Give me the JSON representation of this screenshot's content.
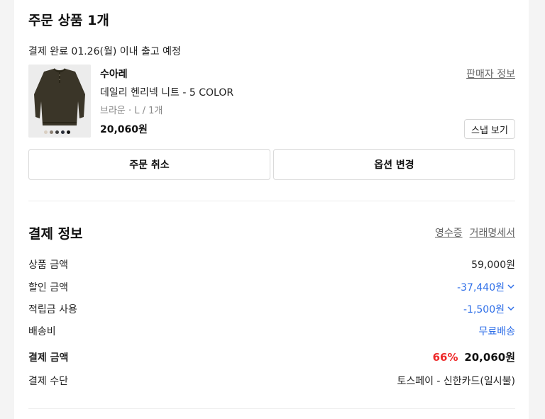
{
  "order_items": {
    "title": "주문 상품 1개",
    "shipping_note": "결제 완료 01.26(월) 이내 출고 예정",
    "product": {
      "brand": "수아레",
      "name": "데일리 헨리넥 니트 - 5 COLOR",
      "option": "브라운 · L / 1개",
      "price": "20,060원",
      "seller_info_link": "판매자 정보",
      "snap_button": "스냅 보기",
      "color_swatches": [
        "#d9cfc2",
        "#8a7f72",
        "#3b3b3b",
        "#2b2f3a",
        "#111111"
      ]
    },
    "cancel_button": "주문 취소",
    "change_option_button": "옵션 변경"
  },
  "payment": {
    "title": "결제 정보",
    "receipt_link": "영수증",
    "statement_link": "거래명세서",
    "rows": [
      {
        "label": "상품 금액",
        "value": "59,000원"
      },
      {
        "label": "할인 금액",
        "value": "-37,440원"
      },
      {
        "label": "적립금 사용",
        "value": "-1,500원"
      },
      {
        "label": "배송비",
        "value": "무료배송"
      }
    ],
    "total": {
      "label": "결제 금액",
      "discount_rate": "66%",
      "value": "20,060원"
    },
    "method": {
      "label": "결제 수단",
      "value": "토스페이 - 신한카드(일시불)"
    }
  },
  "colors": {
    "accent_blue": "#2f6fe8",
    "accent_red": "#ee2a2a",
    "background": "#f4f4f4"
  }
}
